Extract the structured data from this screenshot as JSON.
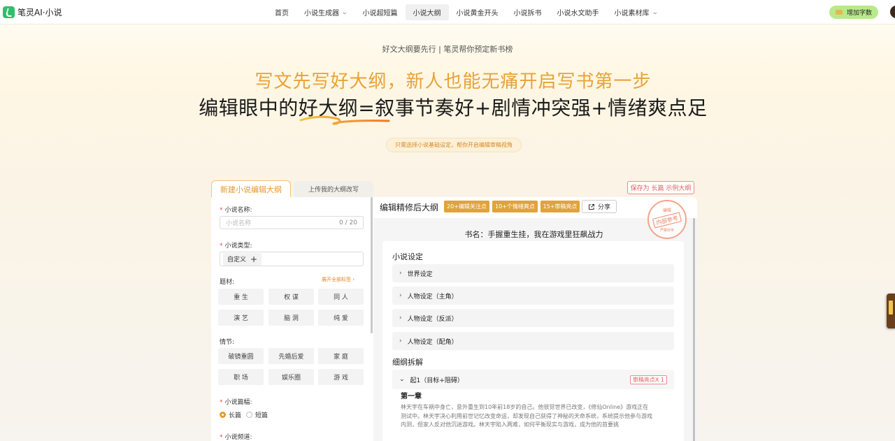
{
  "nav": {
    "logo": "笔灵AI·小说",
    "items": [
      {
        "label": "首页",
        "chevron": false,
        "active": false
      },
      {
        "label": "小说生成器",
        "chevron": true,
        "active": false
      },
      {
        "label": "小说超短篇",
        "chevron": false,
        "active": false
      },
      {
        "label": "小说大纲",
        "chevron": false,
        "active": true
      },
      {
        "label": "小说黄金开头",
        "chevron": false,
        "active": false
      },
      {
        "label": "小说拆书",
        "chevron": false,
        "active": false
      },
      {
        "label": "小说水文助手",
        "chevron": false,
        "active": false
      },
      {
        "label": "小说素材库",
        "chevron": true,
        "active": false
      }
    ],
    "add_words": "增加字数"
  },
  "hero": {
    "subtitle": "好文大纲要先行 | 笔灵帮你预定新书榜",
    "title1": "写文先写好大纲，新人也能无痛开启写书第一步",
    "title2": "编辑眼中的好大纲=叙事节奏好+剧情冲突强+情绪爽点足",
    "hint": "只需选择小说基础设定，帮你开启编辑审稿视角"
  },
  "left": {
    "tab_new": "新建小说编辑大纲",
    "tab_upload": "上传我的大纲改写",
    "name_label": "小说名称:",
    "name_placeholder": "小说名称",
    "name_count": "0 / 20",
    "type_label": "小说类型:",
    "type_tag": "自定义",
    "theme_label": "题材:",
    "expand_all": "展开全部标签 ›",
    "themes": [
      "重 生",
      "权 谋",
      "同 人",
      "演 艺",
      "脑 洞",
      "纯 爱"
    ],
    "plot_label": "情节:",
    "plots": [
      "破镜重圆",
      "先婚后爱",
      "家 庭",
      "职 场",
      "娱乐圈",
      "游 戏"
    ],
    "length_label": "小说篇幅:",
    "length_long": "长篇",
    "length_short": "短篇",
    "channel_label": "小说频道:"
  },
  "right": {
    "save": "保存为 长篇 示例大纲",
    "title": "编辑精修后大纲",
    "badges": [
      "20+编辑关注点",
      "10+个情绪爽点",
      "15+审稿亮点"
    ],
    "share": "分享",
    "stamp_top": "编辑",
    "stamp_mid": "内部参考",
    "stamp_bottom": "严禁外传",
    "book_name": "书名：手握重生挂，我在游戏里狂飙战力",
    "setting_title": "小说设定",
    "settings": [
      "世界设定",
      "人物设定（主角）",
      "人物设定（反派）",
      "人物设定（配角）"
    ],
    "outline_title": "细纲拆解",
    "open_item": "起1（目标+阻碍）",
    "highlight": "审稿亮点X 1",
    "chapter": "第一章",
    "chapter_text": "林天宇在车祸中身亡，意外重生到10年前18岁的自己。他很觉世界已改变，《修仙Online》游戏正在测试中。林天宇决心利用前世记忆改变命运，却发现自己获得了神秘的天命系统，系统提示他参与游戏内测，但家人反对他沉迷游戏。林天宇陷入两难，如何平衡现实与游戏，成为他的首要挑"
  }
}
